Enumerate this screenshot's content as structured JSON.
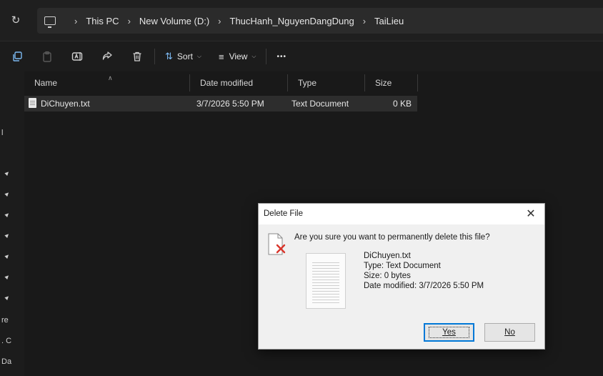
{
  "breadcrumb": {
    "items": [
      "This PC",
      "New Volume (D:)",
      "ThucHanh_NguyenDangDung",
      "TaiLieu"
    ],
    "separator": "›"
  },
  "toolbar": {
    "sort_label": "Sort",
    "view_label": "View",
    "more_label": "•••"
  },
  "columns": {
    "name": "Name",
    "date": "Date modified",
    "type": "Type",
    "size": "Size"
  },
  "files": [
    {
      "name": "DiChuyen.txt",
      "date": "3/7/2026 5:50 PM",
      "type": "Text Document",
      "size": "0 KB"
    }
  ],
  "leftnav": {
    "fragments": [
      "l",
      "re",
      ". C",
      "Da"
    ]
  },
  "dialog": {
    "title": "Delete File",
    "close": "✕",
    "question": "Are you sure you want to permanently delete this file?",
    "file_name": "DiChuyen.txt",
    "file_type": "Type: Text Document",
    "file_size": "Size: 0 bytes",
    "file_date": "Date modified: 3/7/2026 5:50 PM",
    "yes_label": "Yes",
    "no_label": "No"
  },
  "colors": {
    "accent": "#0078d7",
    "icon_blue": "#7cb9f2",
    "warning_red": "#d9362c"
  }
}
